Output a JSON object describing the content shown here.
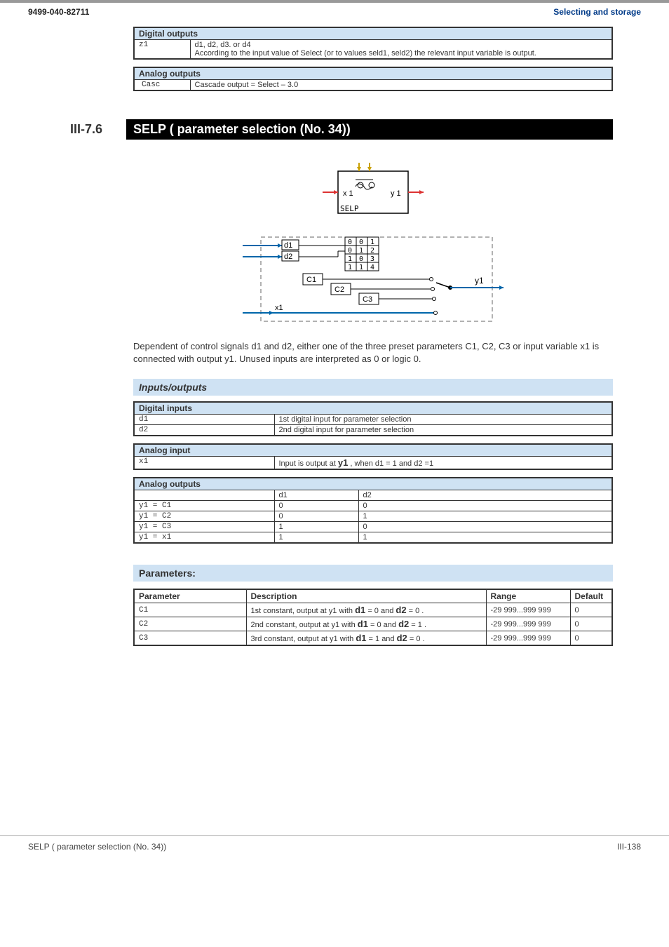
{
  "header": {
    "left": "9499-040-82711",
    "right": "Selecting and storage"
  },
  "digital_outputs": {
    "title": "Digital outputs",
    "rows": [
      {
        "key": "z1",
        "line1": "d1, d2, d3. or d4",
        "line2": "According to the input value of Select (or to values seld1, seld2) the relevant input variable is output."
      }
    ]
  },
  "analog_outputs_top": {
    "title": "Analog outputs",
    "rows": [
      {
        "key": "Casc",
        "desc": "Cascade output = Select – 3.0"
      }
    ]
  },
  "section": {
    "num": "III-7.6",
    "title": "SELP ( parameter selection (No. 34))"
  },
  "diagram": {
    "block_label": "SELP",
    "x1": "x 1",
    "y1": "y 1",
    "d1": "d1",
    "d2": "d2",
    "c1": "C1",
    "c2": "C2",
    "c3": "C3",
    "x1b": "x1",
    "y1b": "y1",
    "truth": [
      [
        "0",
        "0",
        "1"
      ],
      [
        "0",
        "1",
        "2"
      ],
      [
        "1",
        "0",
        "3"
      ],
      [
        "1",
        "1",
        "4"
      ]
    ]
  },
  "description": "Dependent of control signals d1 and d2, either one of the three preset parameters C1, C2, C3 or input variable x1 is connected with output y1. Unused inputs are interpreted as 0 or logic 0.",
  "io_heading": "Inputs/outputs",
  "digital_inputs": {
    "title": "Digital inputs",
    "rows": [
      {
        "key": "d1",
        "desc": "1st digital input for parameter selection"
      },
      {
        "key": "d2",
        "desc": "2nd digital input for parameter  selection"
      }
    ]
  },
  "analog_input": {
    "title": "Analog input",
    "rows": [
      {
        "key": "x1",
        "pre": "Input is output at ",
        "code": "y1",
        "post": " , when d1 = 1 and d2 =1"
      }
    ]
  },
  "analog_outputs_bottom": {
    "title": "Analog outputs",
    "cols": [
      "",
      "d1",
      "d2"
    ],
    "rows": [
      {
        "expr": "y1 = C1",
        "d1": "0",
        "d2": "0"
      },
      {
        "expr": "y1 = C2",
        "d1": "0",
        "d2": "1"
      },
      {
        "expr": "y1 = C3",
        "d1": "1",
        "d2": "0"
      },
      {
        "expr": "y1 = x1",
        "d1": "1",
        "d2": "1"
      }
    ]
  },
  "params_heading": "Parameters:",
  "params": {
    "cols": [
      "Parameter",
      "Description",
      "Range",
      "Default"
    ],
    "rows": [
      {
        "p": "C1",
        "pre": "1st constant, output at y1 with ",
        "b1": "d1",
        "mid1": " = 0 and ",
        "b2": "d2",
        "post": " = 0 .",
        "range": "-29 999...999 999",
        "def": "0"
      },
      {
        "p": "C2",
        "pre": "2nd constant, output at y1 with ",
        "b1": "d1",
        "mid1": " = 0 and ",
        "b2": "d2",
        "post": " = 1 .",
        "range": "-29 999...999 999",
        "def": "0"
      },
      {
        "p": "C3",
        "pre": "3rd constant, output at y1 with ",
        "b1": "d1",
        "mid1": " = 1 and ",
        "b2": "d2",
        "post": " = 0 .",
        "range": "-29 999...999 999",
        "def": "0"
      }
    ]
  },
  "footer": {
    "left": "SELP ( parameter selection (No. 34))",
    "right": "III-138"
  }
}
